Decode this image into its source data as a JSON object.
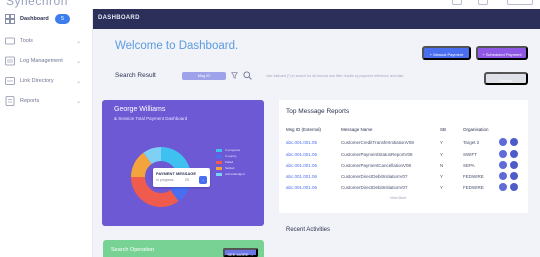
{
  "app": {
    "brand": "Synechron"
  },
  "sidebar": {
    "items": [
      {
        "label": "Dashboard",
        "badge": "5"
      },
      {
        "label": "Tools"
      },
      {
        "label": "Log Management"
      },
      {
        "label": "Link Directory"
      },
      {
        "label": "Reports"
      }
    ]
  },
  "header": {
    "title": "DASHBOARD"
  },
  "main": {
    "welcome": "Welcome to Dashboard.",
    "buttons": {
      "primary": "+ Manual Payment",
      "secondary": "+ Scheduled Payment"
    },
    "search": {
      "label": "Search Result",
      "select_value": "Msg ID",
      "hint": "Use wildcard (*) to search for all records and filter results by payment reference and date.",
      "button": "Search"
    }
  },
  "summary_card": {
    "name": "George Williams",
    "subtitle": "& Session Total Payment Dashboard",
    "legend": [
      "In progress",
      "In expiry",
      "Failed",
      "Settled",
      "Acknowledged"
    ],
    "tooltip": {
      "title": "PAYMENT MESSAGE",
      "subtitle": "In progress",
      "value": "25",
      "action": "→"
    },
    "colors": {
      "card": "#6e59d4",
      "slices": [
        "#3ec1f0",
        "#4a6ef0",
        "#ef5b4c",
        "#f4a43c",
        "#7fd0f5"
      ]
    }
  },
  "donut_data": {
    "type": "pie",
    "categories": [
      "In progress",
      "In expiry",
      "Failed",
      "Settled",
      "Acknowledged"
    ],
    "values": [
      22,
      18,
      35,
      15,
      10
    ]
  },
  "reports": {
    "title": "Top Message Reports",
    "columns": [
      "Msg ID (External)",
      "Message Name",
      "SB",
      "Organisation"
    ],
    "rows": [
      {
        "id": "abc.001.001.05",
        "name": "CustomerCreditTransferInitiationV08",
        "sb": "Y",
        "org": "Target 2"
      },
      {
        "id": "abc.001.001.06",
        "name": "CustomerPaymentStatusReportV08",
        "sb": "Y",
        "org": "SWIFT"
      },
      {
        "id": "abc.001.001.06",
        "name": "CustomerPaymentCancellationV08",
        "sb": "N",
        "org": "SEPA"
      },
      {
        "id": "abc.001.001.06",
        "name": "CustomerDirectDebitInitiationV07",
        "sb": "Y",
        "org": "FEDWIRE"
      },
      {
        "id": "abc.001.001.06",
        "name": "CustomerDirectDebitInitiationV07",
        "sb": "Y",
        "org": "FEDWIRE"
      }
    ],
    "view_more": "View More"
  },
  "recent": {
    "title": "Recent Activities"
  },
  "bottom_card": {
    "title": "Search Operation",
    "button": "SEE MORE →"
  }
}
